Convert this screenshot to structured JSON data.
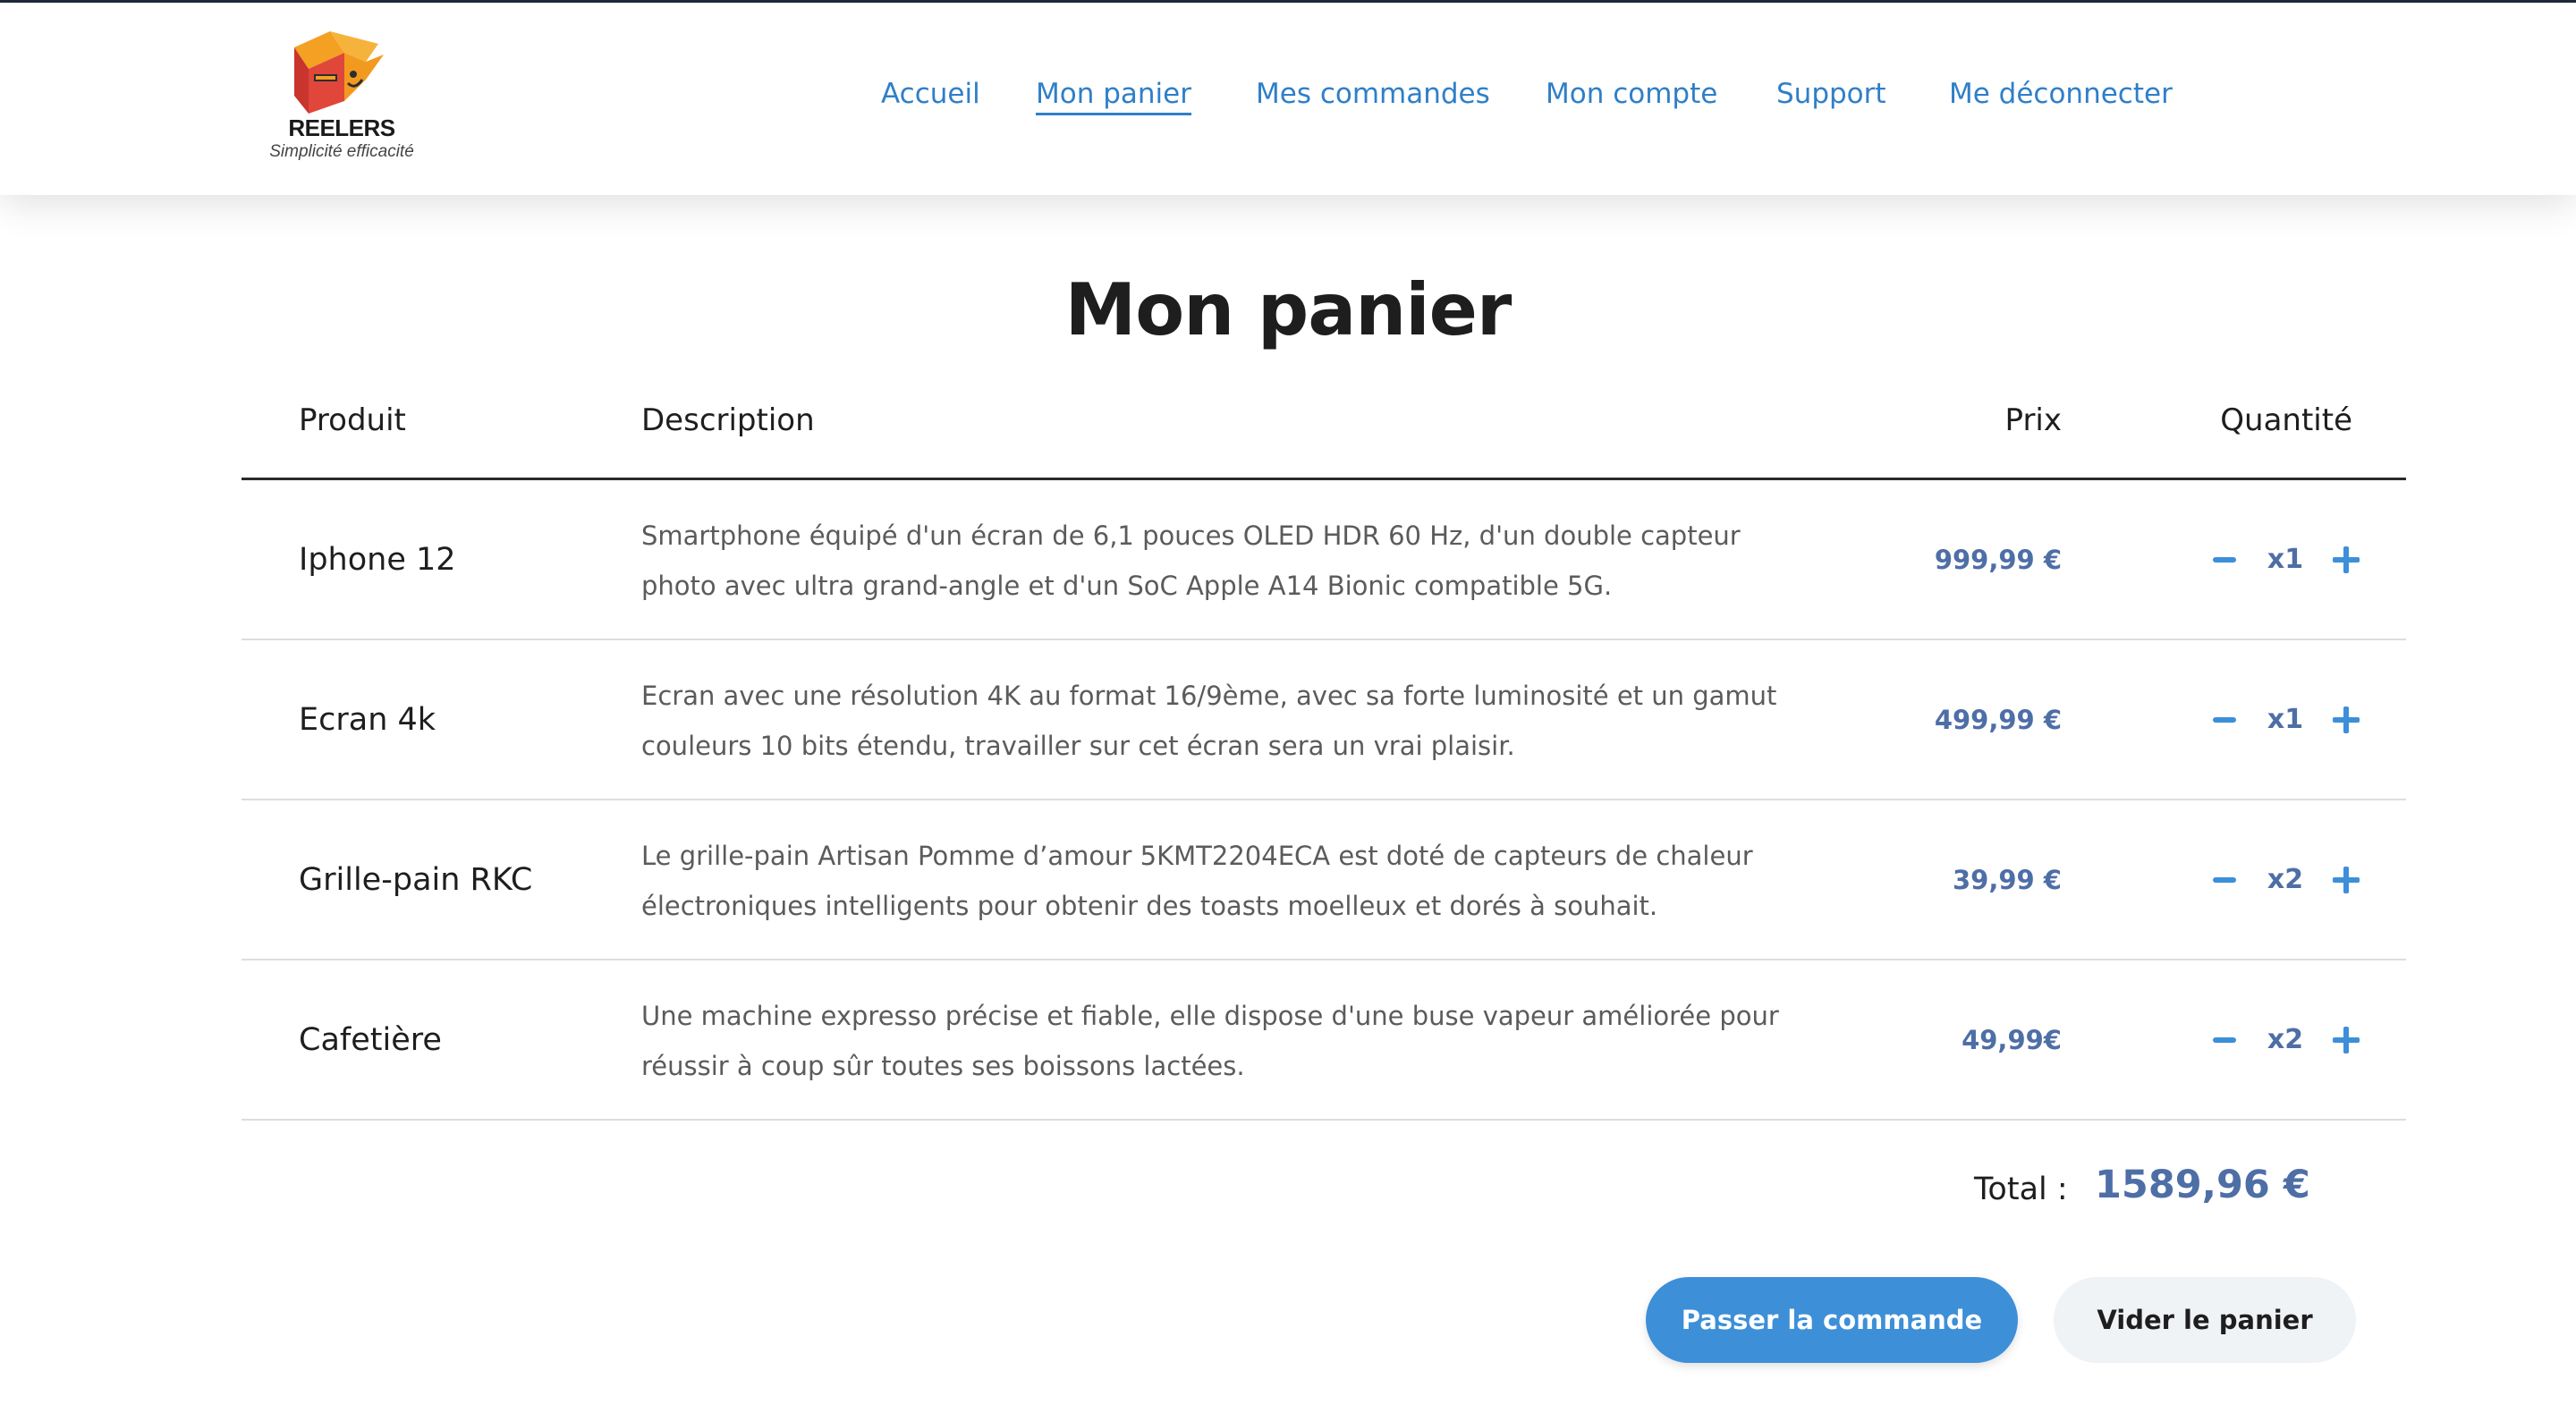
{
  "brand": {
    "name": "REELERS",
    "tagline": "Simplicité efficacité"
  },
  "nav": {
    "items": [
      {
        "label": "Accueil"
      },
      {
        "label": "Mon panier"
      },
      {
        "label": "Mes commandes"
      },
      {
        "label": "Mon compte"
      },
      {
        "label": "Support"
      },
      {
        "label": "Me déconnecter"
      }
    ],
    "active": "Mon panier"
  },
  "page": {
    "title": "Mon panier"
  },
  "table": {
    "headers": {
      "product": "Produit",
      "description": "Description",
      "price": "Prix",
      "quantity": "Quantité"
    },
    "rows": [
      {
        "product": "Iphone 12",
        "description": "Smartphone équipé d'un écran de 6,1 pouces OLED HDR 60 Hz, d'un double capteur photo avec ultra grand-angle et d'un SoC Apple A14 Bionic compatible 5G.",
        "price": "999,99 €",
        "quantity": "x1"
      },
      {
        "product": "Ecran 4k",
        "description": "Ecran avec une résolution 4K au format 16/9ème, avec sa forte luminosité et un gamut couleurs 10 bits étendu, travailler sur cet écran sera un vrai plaisir.",
        "price": "499,99 €",
        "quantity": "x1"
      },
      {
        "product": "Grille-pain RKC",
        "description": "Le grille-pain Artisan Pomme d’amour 5KMT2204ECA est doté de capteurs de chaleur électroniques intelligents pour obtenir des toasts moelleux et dorés à souhait.",
        "price": "39,99 €",
        "quantity": "x2"
      },
      {
        "product": "Cafetière",
        "description": "Une machine expresso précise et fiable, elle dispose d'une buse vapeur améliorée pour réussir à coup sûr toutes ses boissons lactées.",
        "price": "49,99€",
        "quantity": "x2"
      }
    ]
  },
  "total": {
    "label": "Total :",
    "value": "1589,96 €"
  },
  "actions": {
    "order": "Passer la commande",
    "clear": "Vider le panier"
  },
  "colors": {
    "accent": "#2f7fc8",
    "price": "#4e6ea6",
    "button_primary": "#3d8fd8"
  }
}
